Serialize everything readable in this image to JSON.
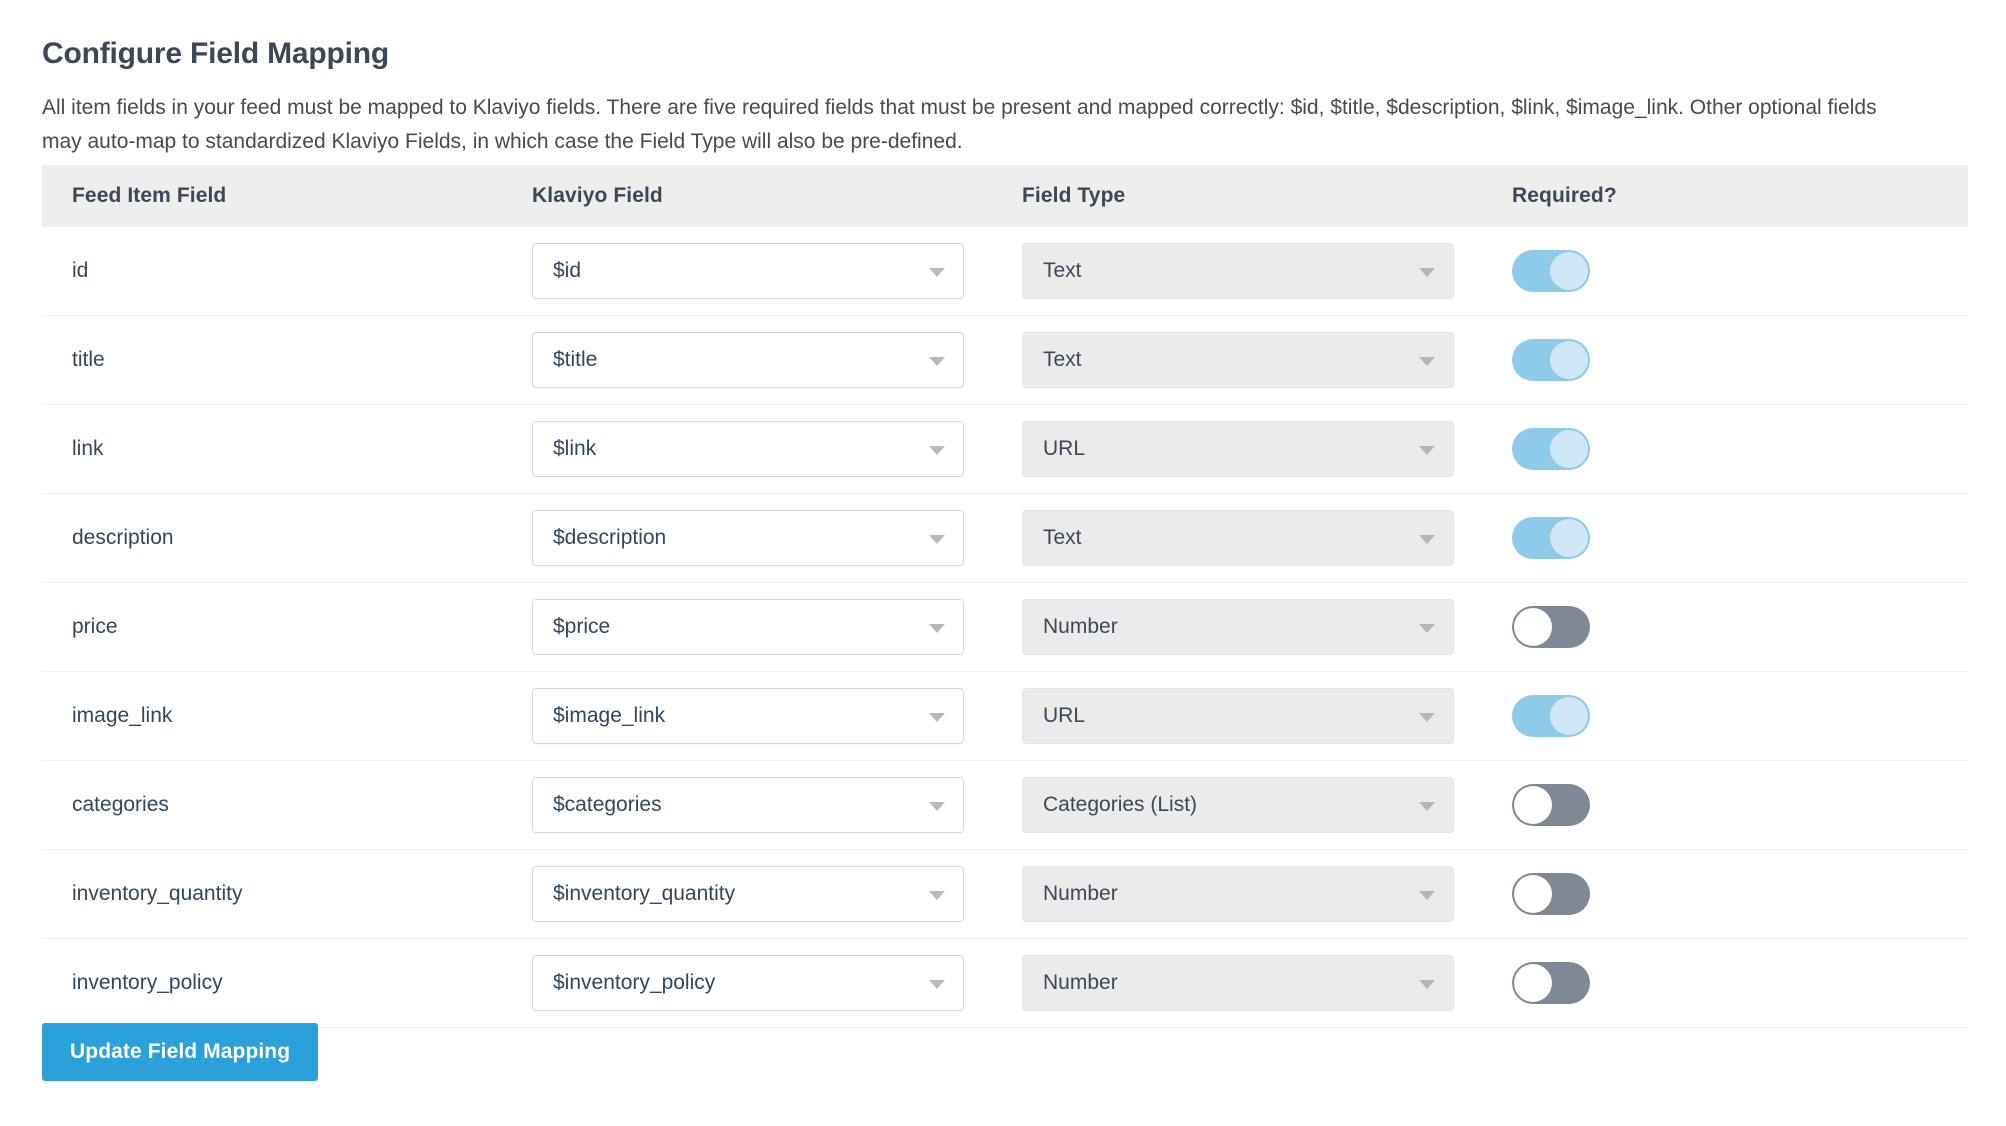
{
  "page": {
    "title": "Configure Field Mapping",
    "description": "All item fields in your feed must be mapped to Klaviyo fields. There are five required fields that must be present and mapped correctly: $id, $title, $description, $link, $image_link. Other optional fields may auto-map to standardized Klaviyo Fields, in which case the Field Type will also be pre-defined."
  },
  "table": {
    "headers": {
      "feed_item_field": "Feed Item Field",
      "klaviyo_field": "Klaviyo Field",
      "field_type": "Field Type",
      "required": "Required?"
    },
    "rows": [
      {
        "feed_item_field": "id",
        "klaviyo_field": "$id",
        "field_type": "Text",
        "required": true
      },
      {
        "feed_item_field": "title",
        "klaviyo_field": "$title",
        "field_type": "Text",
        "required": true
      },
      {
        "feed_item_field": "link",
        "klaviyo_field": "$link",
        "field_type": "URL",
        "required": true
      },
      {
        "feed_item_field": "description",
        "klaviyo_field": "$description",
        "field_type": "Text",
        "required": true
      },
      {
        "feed_item_field": "price",
        "klaviyo_field": "$price",
        "field_type": "Number",
        "required": false
      },
      {
        "feed_item_field": "image_link",
        "klaviyo_field": "$image_link",
        "field_type": "URL",
        "required": true
      },
      {
        "feed_item_field": "categories",
        "klaviyo_field": "$categories",
        "field_type": "Categories (List)",
        "required": false
      },
      {
        "feed_item_field": "inventory_quantity",
        "klaviyo_field": "$inventory_quantity",
        "field_type": "Number",
        "required": false
      },
      {
        "feed_item_field": "inventory_policy",
        "klaviyo_field": "$inventory_policy",
        "field_type": "Number",
        "required": false
      }
    ]
  },
  "actions": {
    "update_field_mapping": "Update Field Mapping"
  },
  "colors": {
    "primary_button": "#2ba0db",
    "toggle_on": "#8ecaea",
    "toggle_on_knob": "#cfe7f6",
    "toggle_off": "#7f8996",
    "toggle_off_knob": "#ffffff",
    "header_row_bg": "#eeeeee",
    "title_text": "#3c4858",
    "field_type_bg": "#ebebeb"
  }
}
